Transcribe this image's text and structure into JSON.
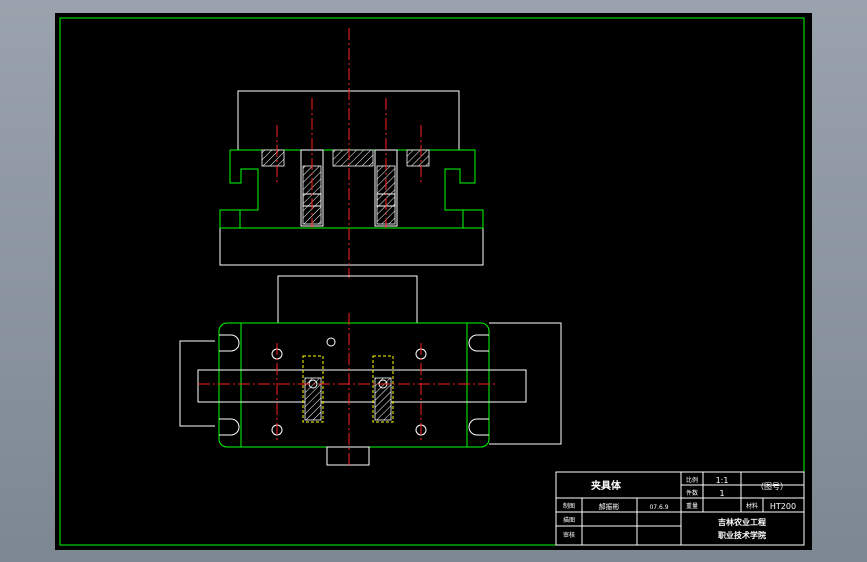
{
  "title_block": {
    "part_name": "夹具体",
    "scale_label": "比例",
    "scale_value": "1:1",
    "quantity_label": "件数",
    "quantity_value": "1",
    "weight_label": "重量",
    "material_label": "材料",
    "material_value": "HT200",
    "drawing_no": "（图号）",
    "designer_label": "制图",
    "designer_name": "郝振彬",
    "date": "07.6.9",
    "drawer_label": "描图",
    "reviewer_label": "审核",
    "school_line1": "吉林农业工程",
    "school_line2": "职业技术学院"
  },
  "colors": {
    "background": "#000000",
    "outline": "#00ff00",
    "edges": "#ffffff",
    "centerlines": "#ff2020",
    "hidden": "#ffff00"
  }
}
